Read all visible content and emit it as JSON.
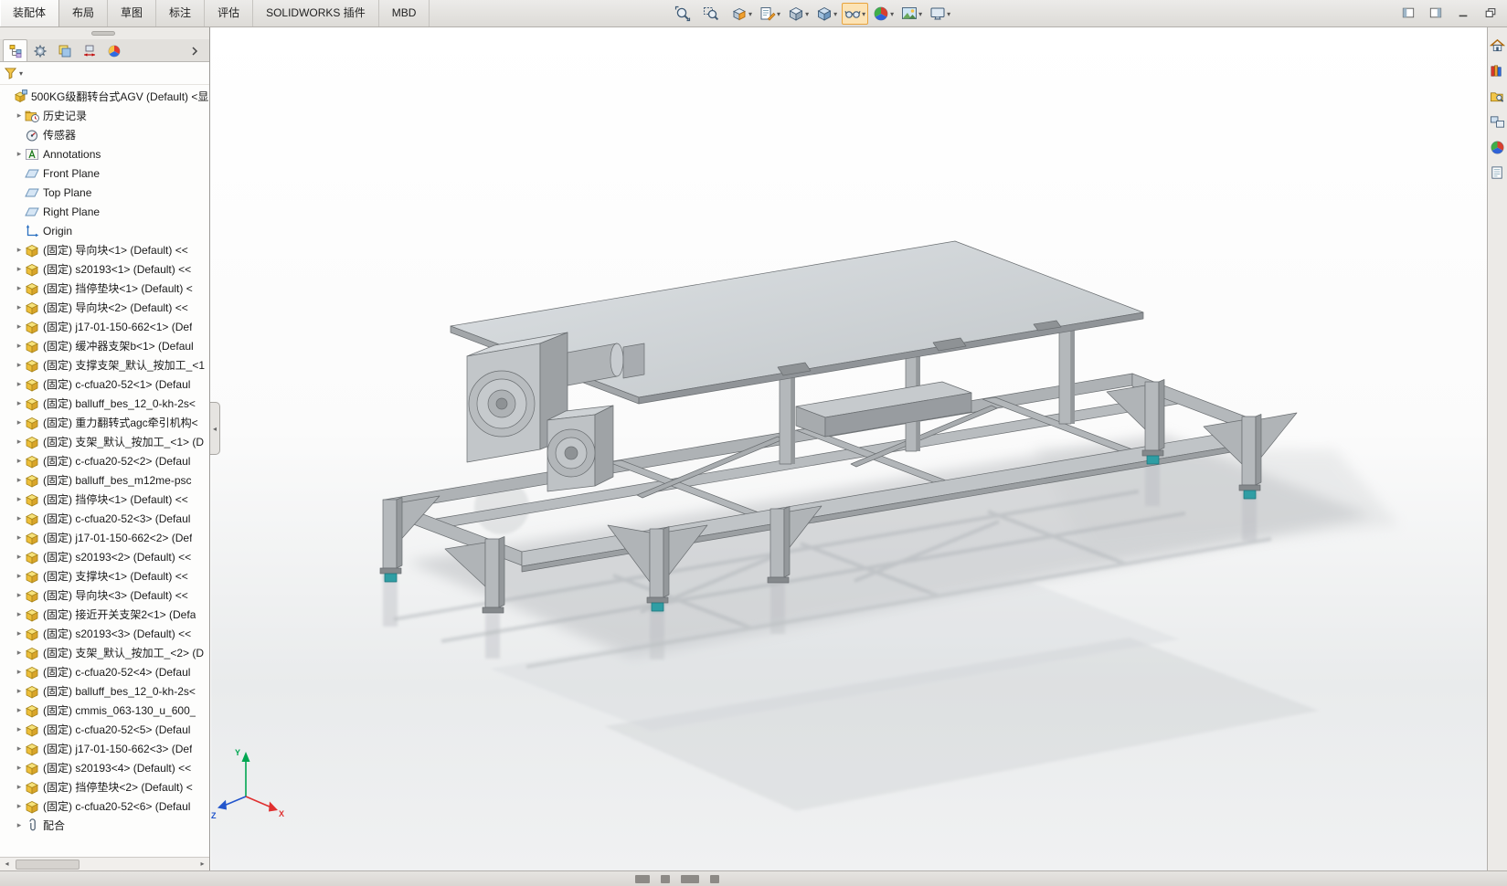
{
  "top_bar": {
    "tabs": [
      {
        "label": "装配体",
        "active": true
      },
      {
        "label": "布局",
        "active": false
      },
      {
        "label": "草图",
        "active": false
      },
      {
        "label": "标注",
        "active": false
      },
      {
        "label": "评估",
        "active": false
      },
      {
        "label": "SOLIDWORKS 插件",
        "active": false
      },
      {
        "label": "MBD",
        "active": false
      }
    ],
    "hud_buttons": [
      {
        "icon": "zoom-fit",
        "dropdown": false,
        "active": false
      },
      {
        "icon": "zoom-area",
        "dropdown": false,
        "active": false
      },
      {
        "icon": "section-view",
        "dropdown": true,
        "active": false
      },
      {
        "icon": "annotation-view",
        "dropdown": true,
        "active": false
      },
      {
        "icon": "view-orientation",
        "dropdown": true,
        "active": false
      },
      {
        "icon": "display-style",
        "dropdown": true,
        "active": false
      },
      {
        "icon": "hide-show-items",
        "dropdown": true,
        "active": true
      },
      {
        "icon": "edit-appearance",
        "dropdown": true,
        "active": false
      },
      {
        "icon": "apply-scene",
        "dropdown": true,
        "active": false
      },
      {
        "icon": "view-settings",
        "dropdown": true,
        "active": false
      }
    ],
    "window_buttons": [
      {
        "icon": "pane-left"
      },
      {
        "icon": "pane-right"
      },
      {
        "icon": "minimize"
      },
      {
        "icon": "restore"
      }
    ]
  },
  "left_panel": {
    "tabs": [
      {
        "icon": "feature-tree-tab",
        "active": true
      },
      {
        "icon": "property-tab",
        "active": false
      },
      {
        "icon": "configuration-tab",
        "active": false
      },
      {
        "icon": "dimxpert-tab",
        "active": false
      },
      {
        "icon": "display-tab",
        "active": false
      },
      {
        "icon": "tab-expand",
        "active": false
      }
    ],
    "tree_items": [
      {
        "icon": "assembly",
        "label": "500KG级翻转台式AGV (Default) <显",
        "expand": false,
        "level": 0
      },
      {
        "icon": "history",
        "label": "历史记录",
        "expand": true,
        "level": 1
      },
      {
        "icon": "sensors",
        "label": "传感器",
        "expand": false,
        "level": 1
      },
      {
        "icon": "annotations",
        "label": "Annotations",
        "expand": true,
        "level": 1
      },
      {
        "icon": "plane",
        "label": "Front Plane",
        "expand": false,
        "level": 1
      },
      {
        "icon": "plane",
        "label": "Top Plane",
        "expand": false,
        "level": 1
      },
      {
        "icon": "plane",
        "label": "Right Plane",
        "expand": false,
        "level": 1
      },
      {
        "icon": "origin",
        "label": "Origin",
        "expand": false,
        "level": 1
      },
      {
        "icon": "component",
        "label": "(固定) 导向块<1> (Default) <<",
        "expand": true,
        "level": 1
      },
      {
        "icon": "component",
        "label": "(固定) s20193<1> (Default) <<",
        "expand": true,
        "level": 1
      },
      {
        "icon": "component",
        "label": "(固定) 挡停垫块<1> (Default) <",
        "expand": true,
        "level": 1
      },
      {
        "icon": "component",
        "label": "(固定) 导向块<2> (Default) <<",
        "expand": true,
        "level": 1
      },
      {
        "icon": "component",
        "label": "(固定) j17-01-150-662<1> (Def",
        "expand": true,
        "level": 1
      },
      {
        "icon": "component",
        "label": "(固定) 缓冲器支架b<1> (Defaul",
        "expand": true,
        "level": 1
      },
      {
        "icon": "component",
        "label": "(固定) 支撑支架_默认_按加工_<1",
        "expand": true,
        "level": 1
      },
      {
        "icon": "component",
        "label": "(固定) c-cfua20-52<1> (Defaul",
        "expand": true,
        "level": 1
      },
      {
        "icon": "component",
        "label": "(固定) balluff_bes_12_0-kh-2s<",
        "expand": true,
        "level": 1
      },
      {
        "icon": "component",
        "label": "(固定) 重力翻转式agc牵引机构<",
        "expand": true,
        "level": 1
      },
      {
        "icon": "component",
        "label": "(固定) 支架_默认_按加工_<1> (D",
        "expand": true,
        "level": 1
      },
      {
        "icon": "component",
        "label": "(固定) c-cfua20-52<2> (Defaul",
        "expand": true,
        "level": 1
      },
      {
        "icon": "component",
        "label": "(固定) balluff_bes_m12me-psc",
        "expand": true,
        "level": 1
      },
      {
        "icon": "component",
        "label": "(固定) 挡停块<1> (Default) <<",
        "expand": true,
        "level": 1
      },
      {
        "icon": "component",
        "label": "(固定) c-cfua20-52<3> (Defaul",
        "expand": true,
        "level": 1
      },
      {
        "icon": "component",
        "label": "(固定) j17-01-150-662<2> (Def",
        "expand": true,
        "level": 1
      },
      {
        "icon": "component",
        "label": "(固定) s20193<2> (Default) <<",
        "expand": true,
        "level": 1
      },
      {
        "icon": "component",
        "label": "(固定) 支撑块<1> (Default) <<",
        "expand": true,
        "level": 1
      },
      {
        "icon": "component",
        "label": "(固定) 导向块<3> (Default) <<",
        "expand": true,
        "level": 1
      },
      {
        "icon": "component",
        "label": "(固定) 接近开关支架2<1> (Defa",
        "expand": true,
        "level": 1
      },
      {
        "icon": "component",
        "label": "(固定) s20193<3> (Default) <<",
        "expand": true,
        "level": 1
      },
      {
        "icon": "component",
        "label": "(固定) 支架_默认_按加工_<2> (D",
        "expand": true,
        "level": 1
      },
      {
        "icon": "component",
        "label": "(固定) c-cfua20-52<4> (Defaul",
        "expand": true,
        "level": 1
      },
      {
        "icon": "component",
        "label": "(固定) balluff_bes_12_0-kh-2s<",
        "expand": true,
        "level": 1
      },
      {
        "icon": "component",
        "label": "(固定) cmmis_063-130_u_600_",
        "expand": true,
        "level": 1
      },
      {
        "icon": "component",
        "label": "(固定) c-cfua20-52<5> (Defaul",
        "expand": true,
        "level": 1
      },
      {
        "icon": "component",
        "label": "(固定) j17-01-150-662<3> (Def",
        "expand": true,
        "level": 1
      },
      {
        "icon": "component",
        "label": "(固定) s20193<4> (Default) <<",
        "expand": true,
        "level": 1
      },
      {
        "icon": "component",
        "label": "(固定) 挡停垫块<2> (Default) <",
        "expand": true,
        "level": 1
      },
      {
        "icon": "component",
        "label": "(固定) c-cfua20-52<6> (Defaul",
        "expand": true,
        "level": 1
      },
      {
        "icon": "mates",
        "label": "配合",
        "expand": true,
        "level": 1
      }
    ]
  },
  "task_pane": {
    "icons": [
      {
        "icon": "home"
      },
      {
        "icon": "design-library"
      },
      {
        "icon": "file-explorer"
      },
      {
        "icon": "view-palette"
      },
      {
        "icon": "appearances"
      },
      {
        "icon": "document-properties"
      }
    ]
  },
  "viewport": {
    "model_name": "500KG级翻转台式AGV",
    "triad_axes": {
      "x": "X",
      "y": "Y",
      "z": "Z"
    }
  },
  "colors": {
    "hud_active_bg": "#fce3b5",
    "hud_active_border": "#e8a33d",
    "component_icon_yellow": "#edbf3a",
    "caster_teal": "#2f9ea4",
    "model_gray": "#c0c4c7"
  }
}
